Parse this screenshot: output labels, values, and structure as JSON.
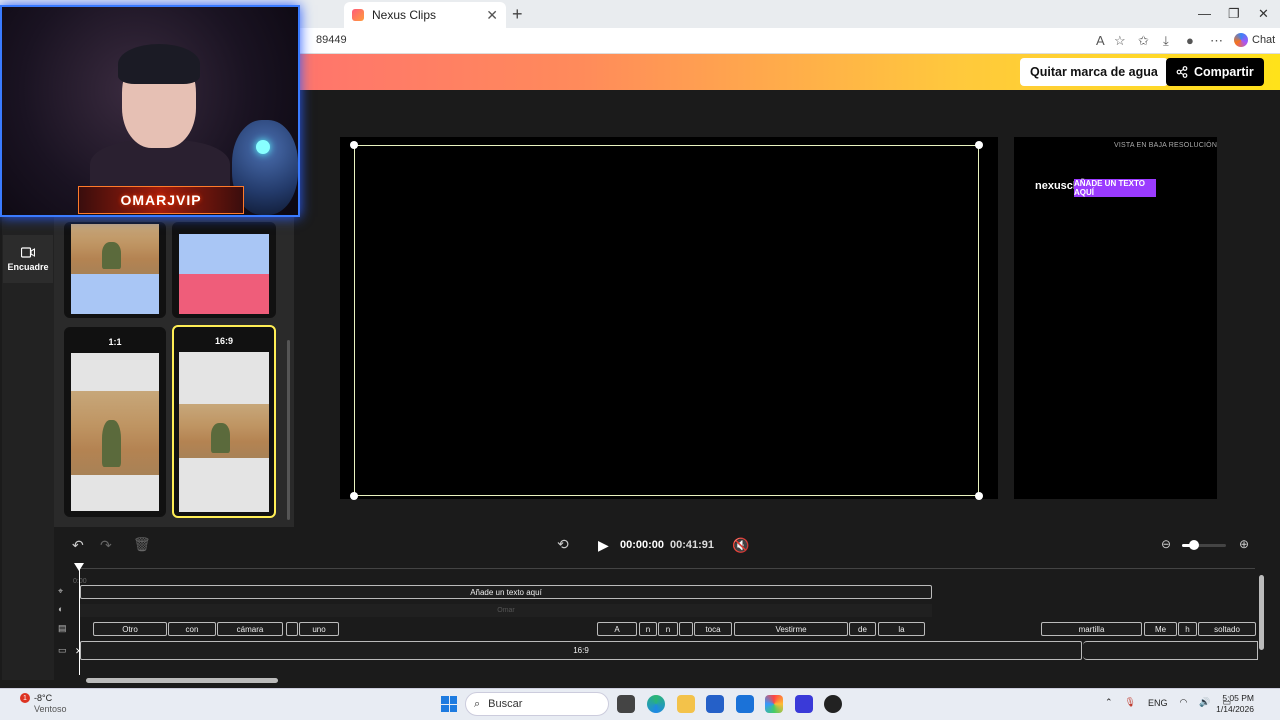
{
  "browser": {
    "tab_title": "Nexus Clips",
    "tab_close": "✕",
    "new_tab": "+",
    "url": "89449",
    "chat_label": "Chat",
    "win_minimize": "—",
    "win_restore": "❐",
    "win_close": "✕"
  },
  "header": {
    "remove_watermark": "Quitar marca de agua",
    "share": "Compartir"
  },
  "sidebar": {
    "encuadre": "Encuadre"
  },
  "formats": [
    {
      "label": "1:1"
    },
    {
      "label": "16:9"
    }
  ],
  "webcam": {
    "streamer_name": "OMARJVIP"
  },
  "preview": {
    "note": "VISTA EN BAJA RESOLUCIÓN",
    "logo": "nexusclip",
    "text_overlay": "AÑADE UN TEXTO AQUÍ"
  },
  "player": {
    "current_time": "00:00:00",
    "total_time": "00:41:91"
  },
  "timeline": {
    "timecode": "0:00",
    "text_clip": "Añade un texto aquí",
    "omar_clip": "Omar",
    "words": [
      "Otro",
      "con",
      "cámara",
      "uno",
      "A",
      "n",
      "n",
      "toca",
      "Vestirme",
      "de",
      "la",
      "martilla",
      "Me",
      "h",
      "soltado"
    ],
    "video_clip": "16:9"
  },
  "taskbar": {
    "weather_temp": "-8°C",
    "weather_desc": "Ventoso",
    "weather_badge": "1",
    "search_placeholder": "Buscar",
    "lang": "ENG",
    "time": "5:05 PM",
    "date": "1/14/2026"
  },
  "colors": {
    "accent_yellow": "#ffee55",
    "header_gradient_start": "#ff5e7e",
    "header_gradient_end": "#ffe21a",
    "overlay_purple": "#9b3bff"
  }
}
